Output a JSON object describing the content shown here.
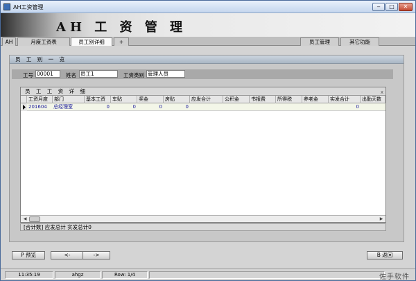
{
  "window": {
    "title": "AH工资管理"
  },
  "banner": {
    "title": "AH 工 资 管 理"
  },
  "tabs": [
    {
      "label": "AH"
    },
    {
      "label": "月度工资表"
    },
    {
      "label": "员工别详细"
    },
    {
      "label": "+"
    }
  ],
  "right_menu": {
    "employee_mgmt": "员工管理",
    "other_functions": "其它功能"
  },
  "panel": {
    "title": "员 工 别 一 览"
  },
  "form": {
    "id_label": "工号",
    "id_value": "00001",
    "name_label": "姓名",
    "name_value": "员工1",
    "type_label": "工资类别",
    "type_value": "管理人员"
  },
  "grid": {
    "title": "员 工 工 资 详 细",
    "close": "x",
    "columns": [
      "工资月度",
      "部门",
      "基本工资",
      "车贴",
      "奖金",
      "房贴",
      "应发合计",
      "公积金",
      "书报费",
      "所得税",
      "养老金",
      "实发合计",
      "出勤天数"
    ],
    "rows": [
      {
        "month": "201604",
        "dept": "总经理室",
        "base": "0",
        "car": "0",
        "bonus": "0",
        "house": "0",
        "gross": "",
        "fund": "",
        "books": "",
        "tax": "",
        "pension": "",
        "net": "0",
        "days": ""
      }
    ]
  },
  "summary": {
    "text": "[合计数] 应发总计   实发总计0"
  },
  "buttons": {
    "preview": "P 预览",
    "prev": "<-",
    "next": "->",
    "back": "B 返回"
  },
  "status": {
    "time": "11:35:19",
    "user": "ahgz",
    "row": "Row: 1/4",
    "brand": "佐手软件"
  }
}
